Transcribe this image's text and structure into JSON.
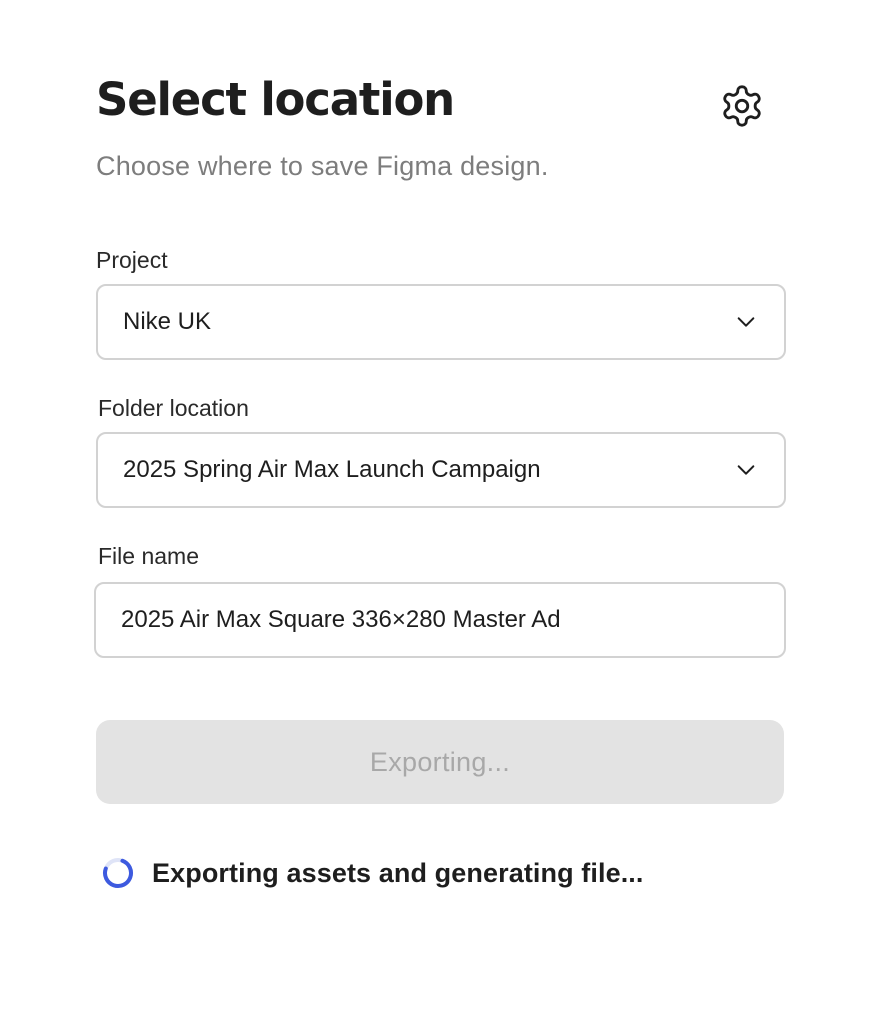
{
  "header": {
    "title": "Select location",
    "subtitle": "Choose where to save Figma design.",
    "settings_icon": "gear-icon"
  },
  "form": {
    "project": {
      "label": "Project",
      "value": "Nike UK",
      "icon": "chevron-down-icon"
    },
    "folder": {
      "label": "Folder location",
      "value": "2025 Spring Air Max Launch Campaign",
      "icon": "chevron-down-icon"
    },
    "file_name": {
      "label": "File name",
      "value": "2025 Air Max Square 336×280 Master Ad"
    }
  },
  "actions": {
    "export_label": "Exporting..."
  },
  "status": {
    "text": "Exporting assets and generating file...",
    "icon": "spinner-icon"
  },
  "colors": {
    "accent": "#3d5adf",
    "button_disabled_bg": "#e3e3e3",
    "button_disabled_text": "#a8a8a8",
    "subtitle": "#7d7d7d"
  }
}
